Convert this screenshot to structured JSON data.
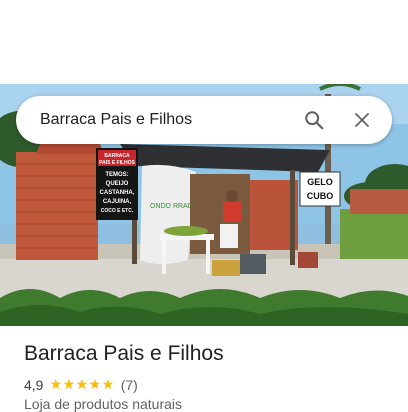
{
  "search": {
    "query": "Barraca Pais e Filhos"
  },
  "icons": {
    "search": "search-icon",
    "close": "close-icon"
  },
  "photo": {
    "banner_lines": [
      "BARRACA",
      "PAIS E FILHOS"
    ],
    "sign_lines": [
      "TEMOS:",
      "QUEIJO",
      "CASTANHA,",
      "CAJUINA,",
      "COCO E ETC."
    ],
    "gelo_lines": [
      "GELO",
      "CUBO"
    ],
    "sack_text": "ONDO RRAD"
  },
  "place": {
    "name": "Barraca Pais e Filhos",
    "rating": "4,9",
    "stars": "★★★★★",
    "reviews": "(7)",
    "category": "Loja de produtos naturais"
  },
  "colors": {
    "accent_star": "#fbbc04",
    "title": "#202124",
    "secondary": "#5f6368"
  }
}
